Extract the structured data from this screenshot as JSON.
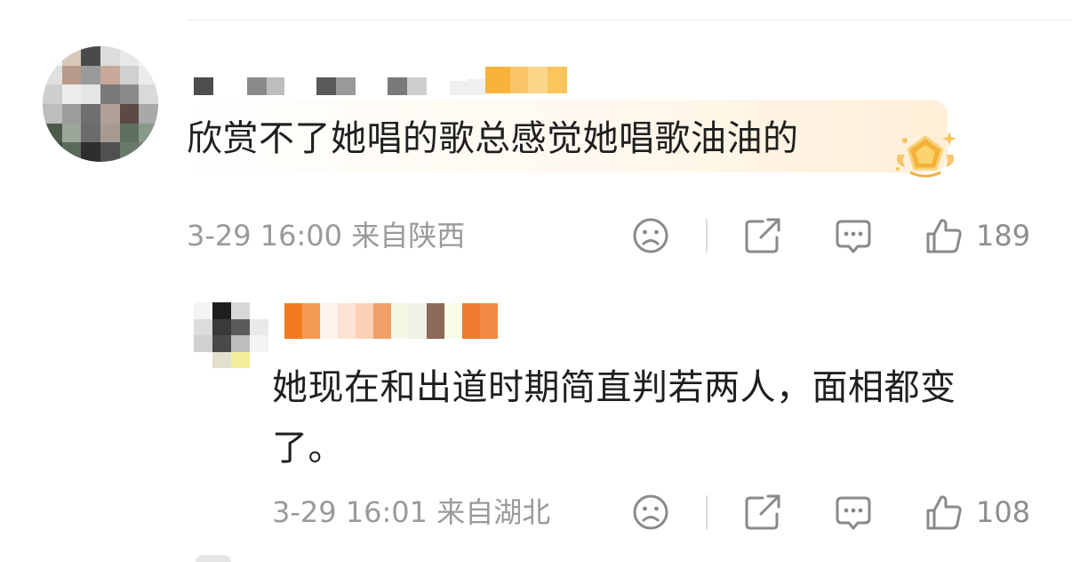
{
  "comment": {
    "text": "欣赏不了她唱的歌总感觉她唱歌油油的",
    "time": "3-29 16:00",
    "location": "来自陕西",
    "likes": "189",
    "icons": [
      "sad-face-icon",
      "share-icon",
      "comment-icon",
      "thumbs-up-icon",
      "gold-badge-icon"
    ]
  },
  "reply": {
    "line1": "她现在和出道时期简直判若两人，面相都变",
    "line2": "了。",
    "time": "3-29 16:01",
    "location": "来自湖北",
    "likes": "108",
    "icons": [
      "sad-face-icon",
      "share-icon",
      "comment-icon",
      "thumbs-up-icon"
    ]
  },
  "colors": {
    "meta_gray": "#9a9a9a",
    "text_dark": "#1f1f1f",
    "badge_gold": "#f6b73c",
    "name_orange": "#f47a1f"
  }
}
